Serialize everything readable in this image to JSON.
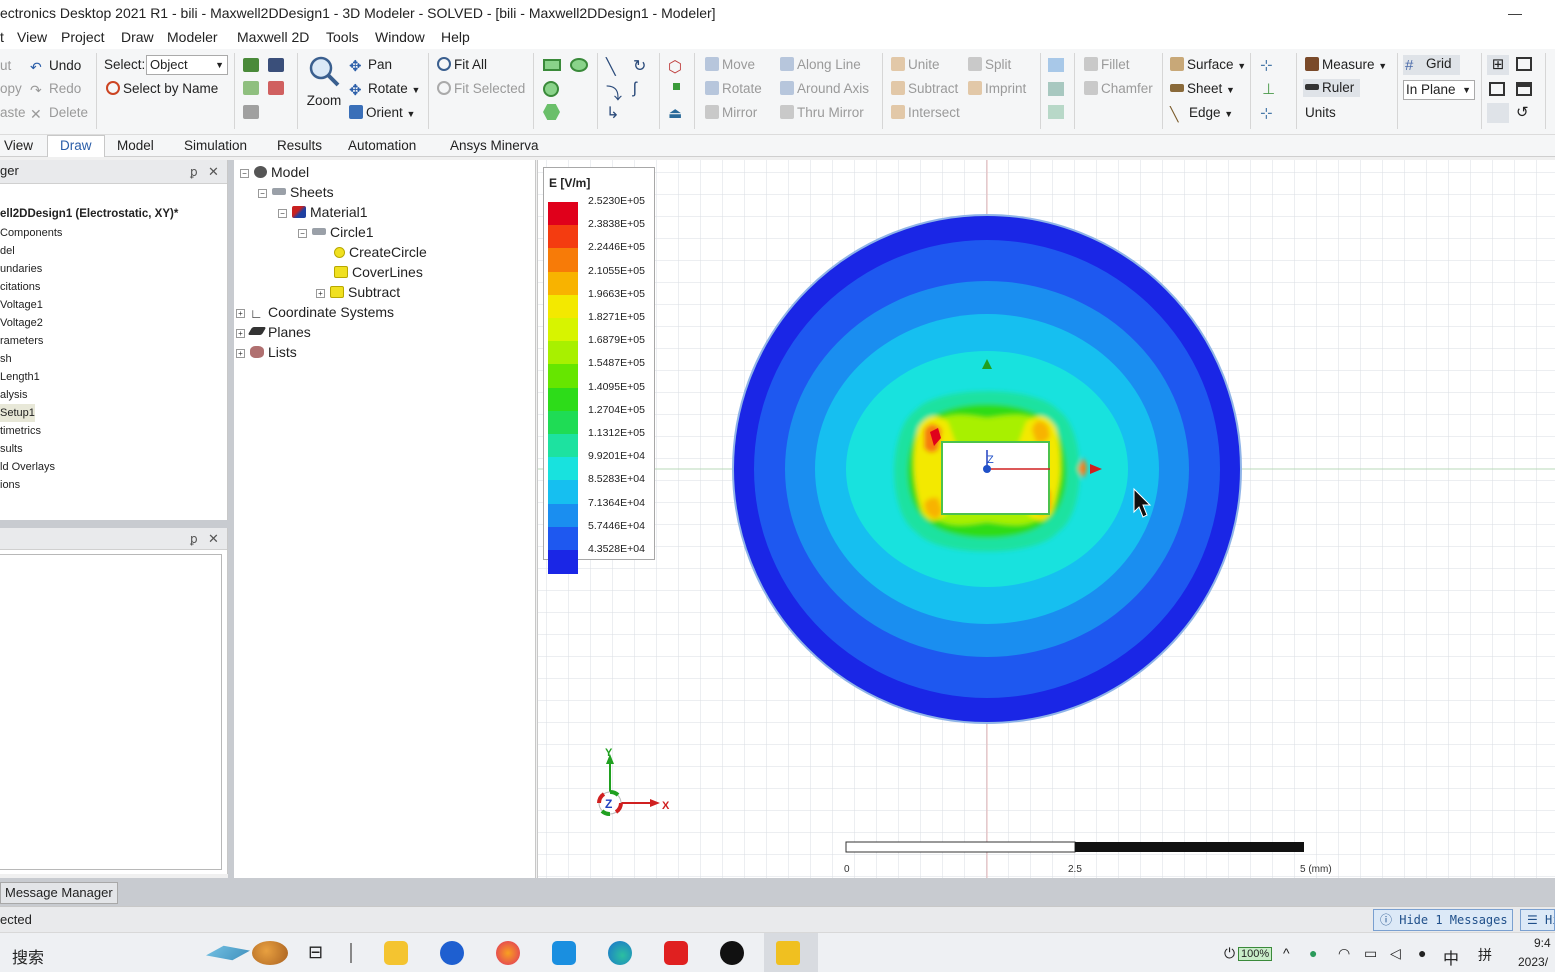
{
  "window": {
    "title": "ectronics Desktop 2021 R1 - bili - Maxwell2DDesign1 - 3D Modeler - SOLVED - [bili - Maxwell2DDesign1 - Modeler]",
    "minimize": "—"
  },
  "menu": [
    "t",
    "View",
    "Project",
    "Draw",
    "Modeler",
    "Maxwell 2D",
    "Tools",
    "Window",
    "Help"
  ],
  "ribbon": {
    "edit": {
      "cut": "ut",
      "copy": "opy",
      "paste": "aste",
      "undo": "Undo",
      "redo": "Redo",
      "delete": "Delete"
    },
    "select_label": "Select:",
    "select_value": "Object",
    "select_by_name": "Select by Name",
    "zoom": "Zoom",
    "pan": "Pan",
    "rotate": "Rotate",
    "orient": "Orient",
    "fit_all": "Fit All",
    "fit_selected": "Fit Selected",
    "move": "Move",
    "rotate2": "Rotate",
    "mirror": "Mirror",
    "along_line": "Along Line",
    "around_axis": "Around Axis",
    "thru_mirror": "Thru Mirror",
    "unite": "Unite",
    "subtract": "Subtract",
    "intersect": "Intersect",
    "split": "Split",
    "imprint": "Imprint",
    "fillet": "Fillet",
    "chamfer": "Chamfer",
    "surface": "Surface",
    "sheet": "Sheet",
    "edge": "Edge",
    "measure": "Measure",
    "ruler": "Ruler",
    "units": "Units",
    "grid": "Grid",
    "in_plane": "In Plane"
  },
  "tabs": [
    "View",
    "Draw",
    "Model",
    "Simulation",
    "Results",
    "Automation",
    "Ansys Minerva"
  ],
  "active_tab": "Draw",
  "project_panel": {
    "title": "ger",
    "design": "ell2DDesign1 (Electrostatic, XY)*",
    "items": [
      "Components",
      "del",
      "undaries",
      "citations",
      "Voltage1",
      "Voltage2",
      "rameters",
      "sh",
      "Length1",
      "alysis",
      "Setup1",
      "timetrics",
      "sults",
      "ld Overlays",
      "ions"
    ]
  },
  "pin_icon": "📌",
  "close_glyph": "✕",
  "model_tree": {
    "items": [
      {
        "label": "Model"
      },
      {
        "label": "Sheets"
      },
      {
        "label": "Material1"
      },
      {
        "label": "Circle1"
      },
      {
        "label": "CreateCircle"
      },
      {
        "label": "CoverLines"
      },
      {
        "label": "Subtract"
      },
      {
        "label": "Coordinate Systems"
      },
      {
        "label": "Planes"
      },
      {
        "label": "Lists"
      }
    ]
  },
  "legend": {
    "title": "E [V/m]",
    "values": [
      "2.5230E+05",
      "2.3838E+05",
      "2.2446E+05",
      "2.1055E+05",
      "1.9663E+05",
      "1.8271E+05",
      "1.6879E+05",
      "1.5487E+05",
      "1.4095E+05",
      "1.2704E+05",
      "1.1312E+05",
      "9.9201E+04",
      "8.5283E+04",
      "7.1364E+04",
      "5.7446E+04",
      "4.3528E+04"
    ],
    "colors": [
      "#e0001b",
      "#f43c10",
      "#f77b08",
      "#f8b300",
      "#f3e900",
      "#d7f400",
      "#a8f000",
      "#66e600",
      "#2ddc19",
      "#1fdc55",
      "#1de2a0",
      "#18e2de",
      "#16bff0",
      "#1a8ef0",
      "#1e58f0",
      "#1a26e6"
    ]
  },
  "axis_triad": {
    "x": "X",
    "y": "Y",
    "z": "Z"
  },
  "scale_bar": {
    "start": "0",
    "mid": "2.5",
    "end": "5 (mm)"
  },
  "message_manager": "Message Manager",
  "status": {
    "left": "ected",
    "hide_messages": "ⓘ Hide 1 Messages",
    "hide_progress": "☰ Hi"
  },
  "taskbar": {
    "search": "搜索",
    "battery": "100%",
    "ime1": "中",
    "ime2": "拼",
    "time": "9:4",
    "date": "2023/"
  },
  "accent_colors": {
    "active_tab": "#2a5da8",
    "field_max": "#e0001b",
    "field_min": "#1a26e6"
  }
}
